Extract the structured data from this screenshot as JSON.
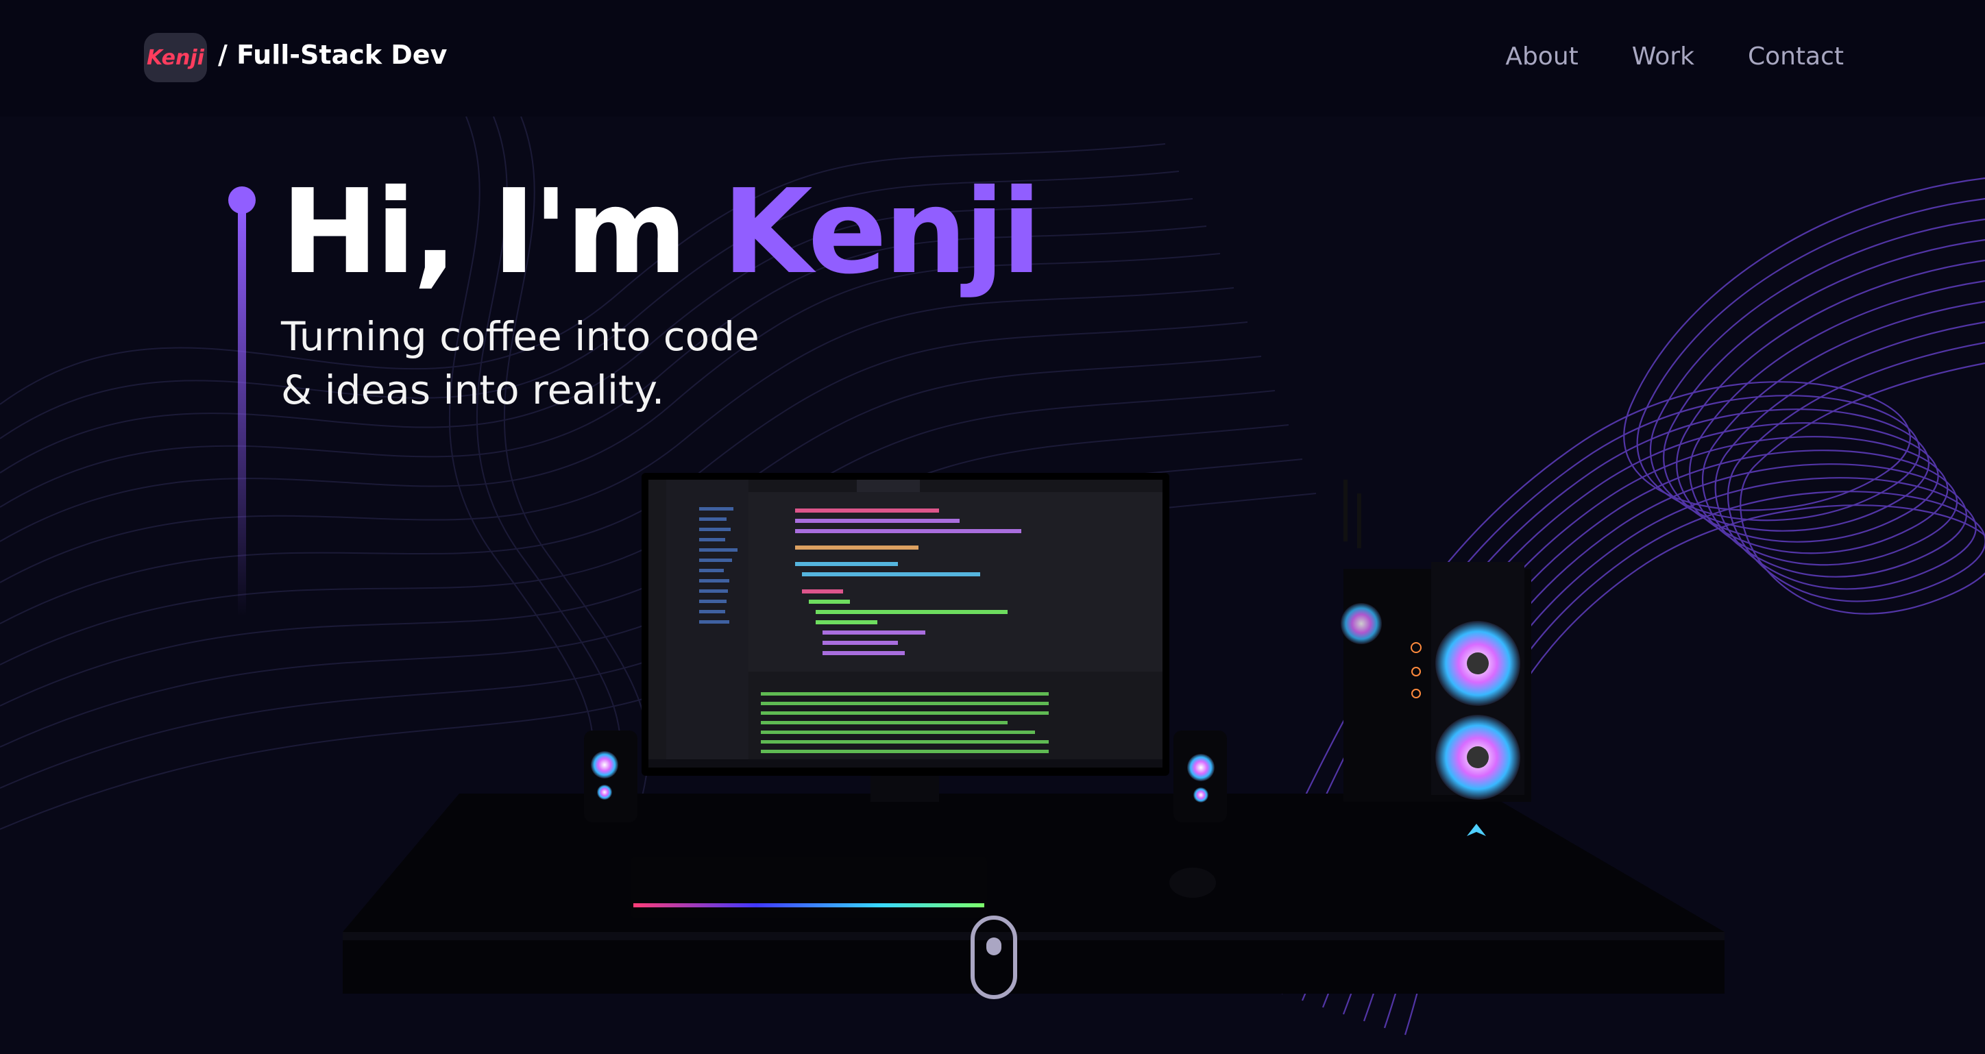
{
  "navbar": {
    "logo_text": "Kenji",
    "brand_title": "/ Full-Stack Dev",
    "links": [
      "About",
      "Work",
      "Contact"
    ]
  },
  "hero": {
    "greeting": "Hi, I'm ",
    "name": "Kenji",
    "tagline_line1": "Turning coffee into code",
    "tagline_line2": "& ideas into reality."
  },
  "colors": {
    "background": "#080817",
    "accent": "#915eff",
    "logo_red": "#ff3d5e",
    "nav_text": "#a9a8c2"
  },
  "icons": [
    "mouse-scroll-icon"
  ]
}
